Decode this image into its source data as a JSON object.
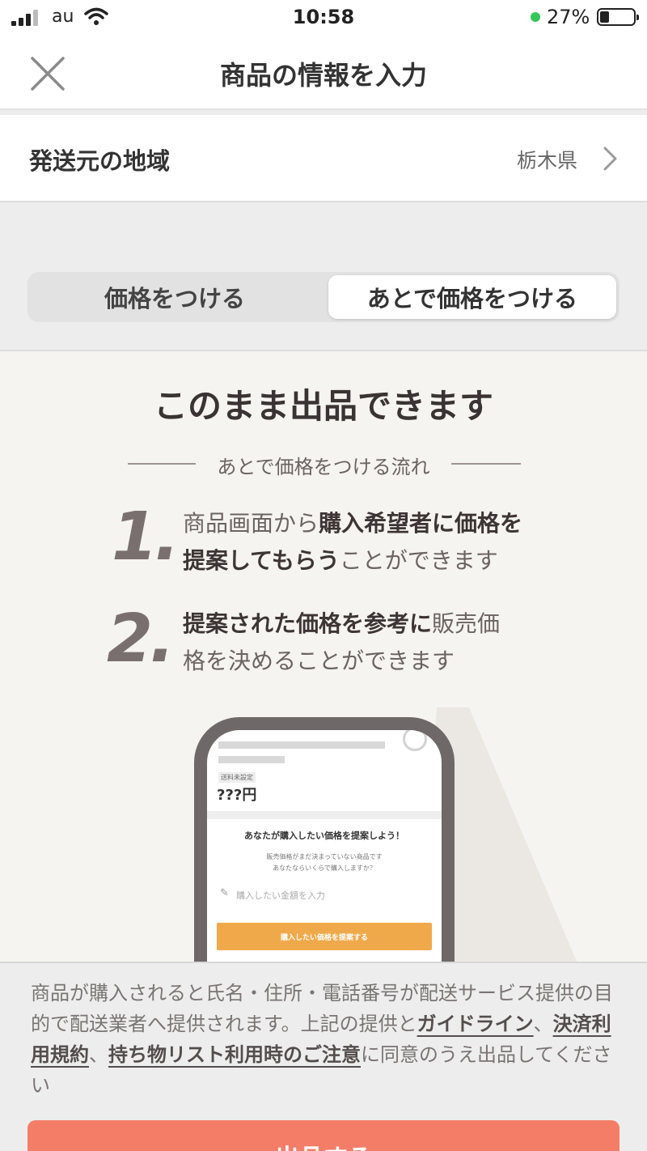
{
  "status_bar": {
    "carrier": "au",
    "time": "10:58",
    "battery_percent": "27%",
    "battery_level": 0.27,
    "icons": [
      "signal-icon",
      "wifi-icon",
      "battery-icon"
    ]
  },
  "nav": {
    "title": "商品の情報を入力",
    "close_icon": "close-icon"
  },
  "shipping_region": {
    "label": "発送元の地域",
    "value": "栃木県",
    "chevron_icon": "chevron-right-icon"
  },
  "price_segment": {
    "options": [
      "価格をつける",
      "あとで価格をつける"
    ],
    "selected": "あとで価格をつける"
  },
  "info": {
    "heading": "このまま出品できます",
    "flow_caption": "あとで価格をつける流れ",
    "steps": [
      {
        "number": "1.",
        "line1_plain": "商品画面から",
        "line1_bold": "購入希望者に価格を",
        "line2_bold": "提案してもらう",
        "line2_plain": "ことができます"
      },
      {
        "number": "2.",
        "line1_bold": "提案された価格を参考に",
        "line1_plain": "販売価",
        "line2_plain": "格を決めることができます"
      }
    ],
    "phone_mock": {
      "tag": "送料未設定",
      "price": "???円",
      "prompt_title": "あなたが購入したい価格を提案しよう！",
      "prompt_sub1": "販売価格がまだ決まっていない商品です",
      "prompt_sub2": "あなたならいくらで購入しますか？",
      "input_placeholder": "購入したい金額を入力",
      "button": "購入したい価格を提案する",
      "button_color": "#f0a94a"
    }
  },
  "footer": {
    "notice_text1": "商品が購入されると氏名・住所・電話番号が配送サービス提供の目的で配送業者へ提供されます。上記の提供と",
    "link_guideline": "ガイドライン",
    "sep1": "、",
    "link_payment_terms": "決済利用規約",
    "sep2": "、",
    "link_belongings": "持ち物リスト利用時のご注意",
    "notice_text2": "に同意のうえ出品してください",
    "submit_label": "出品する",
    "submit_color": "#f47d67"
  }
}
